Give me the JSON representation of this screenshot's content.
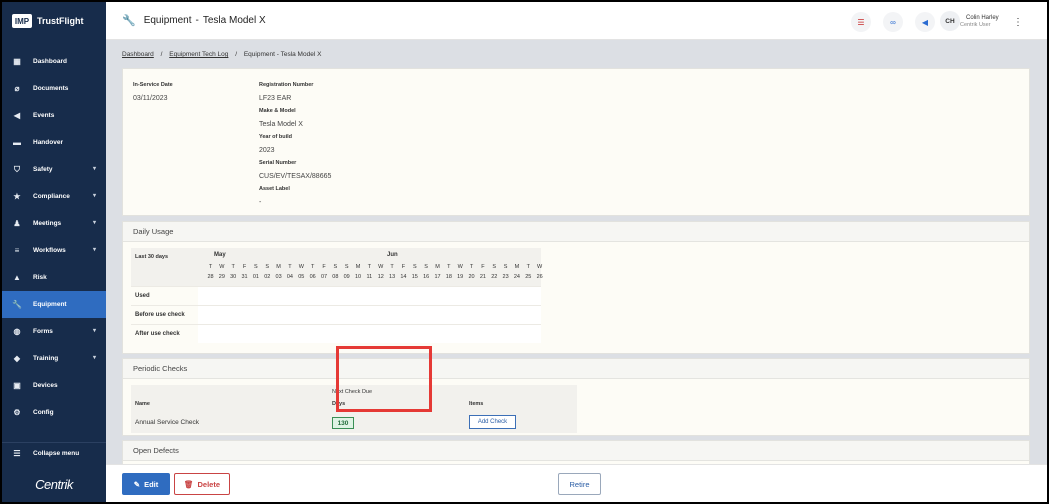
{
  "app": {
    "brand_logo": "IMP",
    "brand_name": "TrustFlight",
    "footer_logo": "Centrik"
  },
  "sidebar": {
    "items": [
      {
        "label": "Dashboard",
        "icon": "dashboard-icon",
        "chevron": false
      },
      {
        "label": "Documents",
        "icon": "paperclip-icon",
        "chevron": false
      },
      {
        "label": "Events",
        "icon": "megaphone-icon",
        "chevron": false
      },
      {
        "label": "Handover",
        "icon": "inbox-icon",
        "chevron": false
      },
      {
        "label": "Safety",
        "icon": "shield-icon",
        "chevron": true
      },
      {
        "label": "Compliance",
        "icon": "badge-icon",
        "chevron": true
      },
      {
        "label": "Meetings",
        "icon": "people-icon",
        "chevron": true
      },
      {
        "label": "Workflows",
        "icon": "workflow-icon",
        "chevron": true
      },
      {
        "label": "Risk",
        "icon": "warning-icon",
        "chevron": false
      },
      {
        "label": "Equipment",
        "icon": "wrench-icon",
        "chevron": false,
        "active": true
      },
      {
        "label": "Forms",
        "icon": "form-icon",
        "chevron": true
      },
      {
        "label": "Training",
        "icon": "graduation-cap-icon",
        "chevron": true
      },
      {
        "label": "Devices",
        "icon": "devices-icon",
        "chevron": false
      },
      {
        "label": "Config",
        "icon": "gears-icon",
        "chevron": false
      }
    ],
    "collapse_label": "Collapse menu"
  },
  "header": {
    "title": "Equipment",
    "subtitle": "Tesla Model X",
    "user": {
      "initials": "CH",
      "name": "Colin Harley",
      "role": "Centrik User"
    }
  },
  "breadcrumb": {
    "items": [
      "Dashboard",
      "Equipment Tech Log",
      "Equipment - Tesla Model X"
    ]
  },
  "details": {
    "in_service_label": "In-Service Date",
    "in_service_value": "03/11/2023",
    "registration_label": "Registration Number",
    "registration_value": "LF23 EAR",
    "make_label": "Make & Model",
    "make_value": "Tesla Model X",
    "year_label": "Year of build",
    "year_value": "2023",
    "serial_label": "Serial Number",
    "serial_value": "CUS/EV/TESAX/88665",
    "asset_label": "Asset Label",
    "asset_value": "-"
  },
  "daily_usage": {
    "title": "Daily Usage",
    "period_label": "Last 30 days",
    "months": [
      "May",
      "Jun"
    ],
    "weekdays": [
      "T",
      "W",
      "T",
      "F",
      "S",
      "S",
      "M",
      "T",
      "W",
      "T",
      "F",
      "S",
      "S",
      "M",
      "T",
      "W",
      "T",
      "F",
      "S",
      "S",
      "M",
      "T",
      "W",
      "T",
      "F",
      "S",
      "S",
      "M",
      "T",
      "W"
    ],
    "dates": [
      "28",
      "29",
      "30",
      "31",
      "01",
      "02",
      "03",
      "04",
      "05",
      "06",
      "07",
      "08",
      "09",
      "10",
      "11",
      "12",
      "13",
      "14",
      "15",
      "16",
      "17",
      "18",
      "19",
      "20",
      "21",
      "22",
      "23",
      "24",
      "25",
      "26"
    ],
    "rows": [
      "Used",
      "Before use check",
      "After use check"
    ]
  },
  "periodic_checks": {
    "title": "Periodic Checks",
    "next_due_label": "Next Check Due",
    "name_header": "Name",
    "days_header": "Days",
    "items_header": "Items",
    "row": {
      "name": "Annual Service Check",
      "days": "130",
      "action_label": "Add Check"
    }
  },
  "open_defects": {
    "title": "Open Defects"
  },
  "footer": {
    "edit_label": "Edit",
    "delete_label": "Delete",
    "retire_label": "Retire"
  },
  "colors": {
    "sidebar": "#172c4b",
    "active": "#2f6cc0",
    "highlight": "#e53935"
  }
}
